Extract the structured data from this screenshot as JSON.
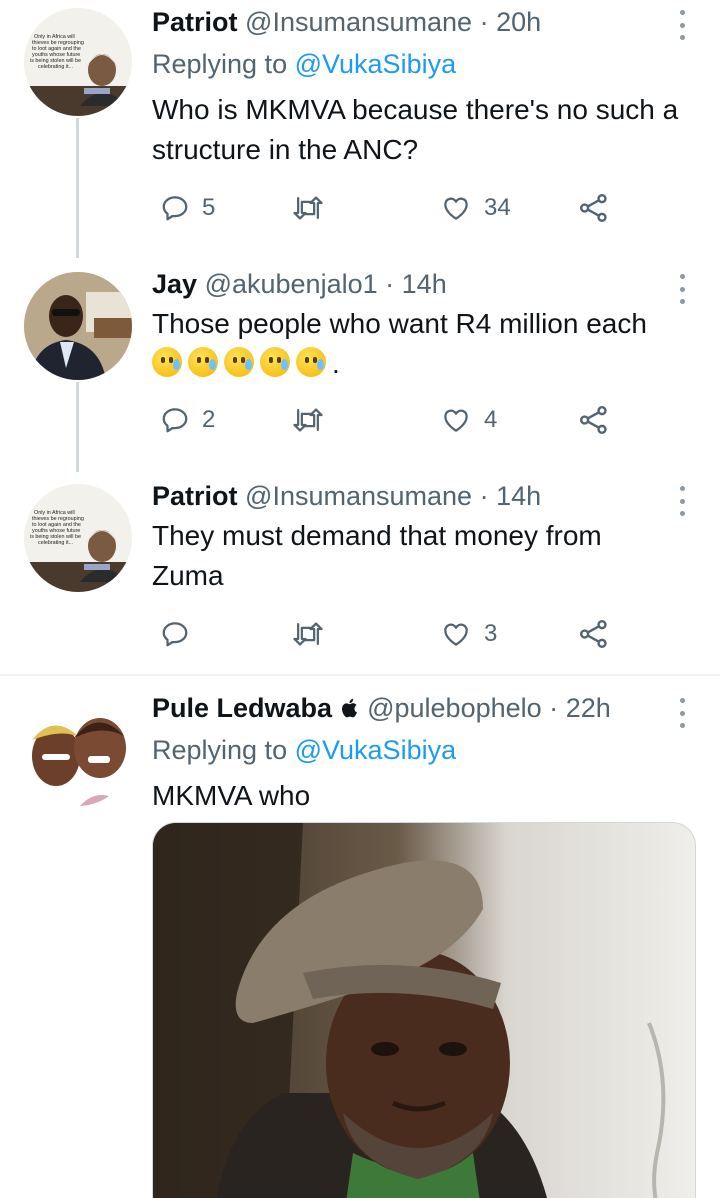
{
  "tweets": [
    {
      "name": "Patriot",
      "handle": "@Insumansumane",
      "dot": "·",
      "time": "20h",
      "replying_label": "Replying to",
      "replying_to": "@VukaSibiya",
      "text": "Who is MKMVA because there's no such a structure in the ANC?",
      "replies": "5",
      "retweets": "",
      "likes": "34"
    },
    {
      "name": "Jay",
      "handle": "@akubenjalo1",
      "dot": "·",
      "time": "14h",
      "text": "Those people who want R4 million each",
      "text_tail": ".",
      "replies": "2",
      "retweets": "",
      "likes": "4"
    },
    {
      "name": "Patriot",
      "handle": "@Insumansumane",
      "dot": "·",
      "time": "14h",
      "text": "They must demand that money from Zuma",
      "replies": "",
      "retweets": "",
      "likes": "3"
    },
    {
      "name": "Pule Ledwaba",
      "verified_glyph": "",
      "handle": "@pulebophelo",
      "dot": "·",
      "time": "22h",
      "replying_label": "Replying to",
      "replying_to": "@VukaSibiya",
      "text": "MKMVA who"
    }
  ],
  "patriot_avatar_text": "Only in Africa will thieves be regrouping to loot again and the youths whose future is being stolen will be celebrating it...",
  "icons": [
    "reply-icon",
    "retweet-icon",
    "like-icon",
    "share-icon",
    "more-icon",
    "apple-icon"
  ],
  "colors": {
    "link": "#1d9bf0",
    "muted": "#536471",
    "text": "#0f1419",
    "thread": "#cfd9de"
  }
}
